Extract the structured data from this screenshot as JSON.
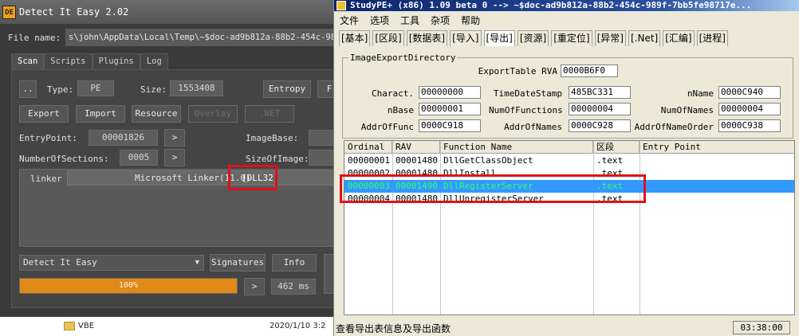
{
  "die": {
    "title": "Detect It Easy 2.02",
    "file_label": "File name:",
    "file_path": "s\\john\\AppData\\Local\\Temp\\~$doc-ad9b812a-88b2-454c-989f-7",
    "tabs": [
      "Scan",
      "Scripts",
      "Plugins",
      "Log"
    ],
    "more_label": "..",
    "type_label": "Type:",
    "type_value": "PE",
    "size_label": "Size:",
    "size_value": "1553408",
    "entropy_label": "Entropy",
    "extra_label": "F",
    "buttons": {
      "export": "Export",
      "import": "Import",
      "resource": "Resource",
      "overlay": "Overlay",
      "net": ".NET"
    },
    "entrypoint_label": "EntryPoint:",
    "entrypoint_value": "00001826",
    "imagebase_label": "ImageBase:",
    "sections_label": "NumberOfSections:",
    "sections_value": "0005",
    "sizeofimage_label": "SizeOfImage:",
    "arrow": ">",
    "sig_type": "linker",
    "sig_value_a": "Microsoft Linker(11.0)",
    "sig_value_b": "[DLL32]",
    "database_select": "Detect It Easy",
    "signatures_label": "Signatures",
    "info_label": "Info",
    "progress_text": "100%",
    "progress_fraction": 1.0,
    "time_value": "462 ms"
  },
  "background": {
    "folder_name": "VBE",
    "date": "2020/1/10 3:2"
  },
  "spe": {
    "title": "StudyPE+ (x86) 1.09 beta 0  --> ~$doc-ad9b812a-88b2-454c-989f-7bb5fe98717e...",
    "menu": [
      "文件",
      "选项",
      "工具",
      "杂项",
      "帮助"
    ],
    "tabs": [
      "[基本]",
      "[区段]",
      "[数据表]",
      "[导入]",
      "[导出]",
      "[资源]",
      "[重定位]",
      "[异常]",
      "[.Net]",
      "[汇编]",
      "[进程]"
    ],
    "active_tab": "[导出]",
    "group_label": "ImageExportDirectory",
    "fields": {
      "export_table_rva_label": "ExportTable RVA",
      "export_table_rva": "0000B6F0",
      "charact_label": "Charact.",
      "charact": "00000000",
      "timedatestamp_label": "TimeDateStamp",
      "timedatestamp": "485BC331",
      "nname_label": "nName",
      "nname": "0000C940",
      "nbase_label": "nBase",
      "nbase": "00000001",
      "numoffunctions_label": "NumOfFunctions",
      "numoffunctions": "00000004",
      "numofnames_label": "NumOfNames",
      "numofnames": "00000004",
      "addroffunc_label": "AddrOfFunc",
      "addroffunc": "0000C918",
      "addrofnames_label": "AddrOfNames",
      "addrofnames": "0000C928",
      "addrofnameorder_label": "AddrOfNameOrder",
      "addrofnameorder": "0000C938"
    },
    "columns": [
      "Ordinal",
      "RAV",
      "Function Name",
      "区段",
      "Entry Point"
    ],
    "rows": [
      {
        "ordinal": "00000001",
        "rav": "00001480",
        "name": "DllGetClassObject",
        "section": ".text",
        "entry": ""
      },
      {
        "ordinal": "00000002",
        "rav": "00001480",
        "name": "DllInstall",
        "section": ".text",
        "entry": ""
      },
      {
        "ordinal": "00000003",
        "rav": "00001490",
        "name": "DllRegisterServer",
        "section": ".text",
        "entry": ""
      },
      {
        "ordinal": "00000004",
        "rav": "00001480",
        "name": "DllUnregisterServer",
        "section": ".text",
        "entry": ""
      }
    ],
    "status_text": "查看导出表信息及导出函数",
    "status_time": "03:38:00"
  }
}
